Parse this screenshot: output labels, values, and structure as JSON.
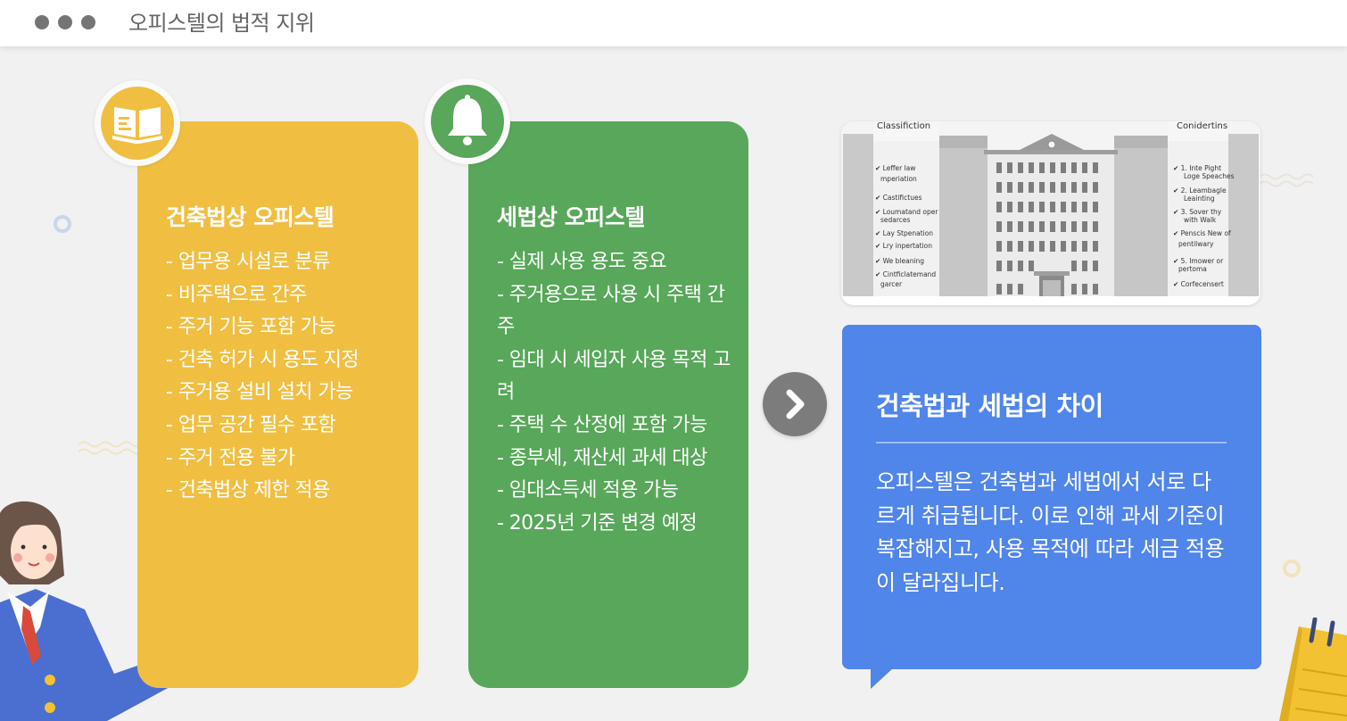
{
  "window": {
    "title": "오피스텔의 법적 지위"
  },
  "cards": [
    {
      "title": "건축법상 오피스텔",
      "icon": "book-icon",
      "items": [
        "- 업무용 시설로 분류",
        "- 비주택으로 간주",
        "- 주거 기능 포함 가능",
        "- 건축 허가 시 용도 지정",
        "- 주거용 설비 설치 가능",
        "- 업무 공간 필수 포함",
        "- 주거 전용 불가",
        "- 건축법상 제한 적용"
      ]
    },
    {
      "title": "세법상 오피스텔",
      "icon": "bell-icon",
      "items": [
        "- 실제 사용 용도 중요",
        "- 주거용으로 사용 시 주택 간주",
        "- 임대 시 세입자 사용 목적 고려",
        "- 주택 수 산정에 포함 가능",
        "- 종부세, 재산세 과세 대상",
        "- 임대소득세 적용 가능",
        "- 2025년 기준 변경 예정"
      ]
    }
  ],
  "image_card": {
    "left_caption": "Classifiction",
    "right_caption": "Conidertins",
    "left_items": [
      "✔ Leffer law",
      "mperiation",
      "✔ Castifictues",
      "✔ Loumatand oper",
      "sedarces",
      "✔ Lay Stpenation",
      "✔ Lry inpertation",
      "✔ We bleaning",
      "✔ Cintficlatemand",
      "garcer"
    ],
    "right_items": [
      "✔ 1. Inte Pight",
      "Loge Speaches",
      "✔ 2. Leambagle",
      "Leainting",
      "✔ 3. Sover thy",
      "with Walk",
      "✔ Penscis New of",
      "pentilwary",
      "✔ 5. Imower or",
      "pertoma",
      "✔ Corfecensert"
    ]
  },
  "summary": {
    "title": "건축법과 세법의 차이",
    "body": "오피스텔은 건축법과 세법에서 서로 다르게 취급됩니다. 이로 인해 과세 기준이 복잡해지고, 사용 목적에 따라 세금 적용이 달라집니다."
  },
  "icons": {
    "window_dots": [
      "dot-icon",
      "dot-icon",
      "dot-icon"
    ],
    "next": "chevron-right-icon"
  },
  "colors": {
    "yellow": "#f0bf42",
    "green": "#58a75a",
    "blue": "#5085e9",
    "grey_button": "#7c7c7c"
  }
}
